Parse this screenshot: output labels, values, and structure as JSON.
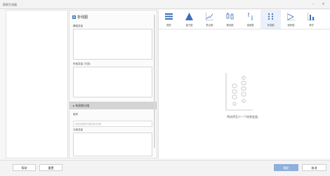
{
  "window": {
    "title": "图表生成器",
    "minimize": "–",
    "close": "×"
  },
  "builder": {
    "title": "折线图",
    "fields": [
      {
        "label": "横轴变量"
      },
      {
        "label": "纵轴变量 (可选)"
      }
    ],
    "section": {
      "label": "▸ 布局和分组"
    },
    "group": {
      "label": "组别",
      "placeholder": "请在此选择分组变量(可选)"
    },
    "panel_label": "分面变量"
  },
  "chart_types": [
    {
      "label": "图形",
      "icon": "chart-menu-icon"
    },
    {
      "label": "直方图",
      "icon": "triangle-icon"
    },
    {
      "label": "散点图",
      "icon": "scatter-icon"
    },
    {
      "label": "箱线图",
      "icon": "boxplot-icon"
    },
    {
      "label": "误差图",
      "icon": "errorbar-icon"
    },
    {
      "label": "折线图",
      "icon": "dotplot-icon",
      "active": true
    },
    {
      "label": "面积图",
      "icon": "area-icon"
    },
    {
      "label": "条形",
      "icon": "bar-icon"
    }
  ],
  "preview": {
    "message": "将选择至少一个结果变量。"
  },
  "footer": {
    "help": "帮助",
    "reset": "重置",
    "ok": "确定",
    "cancel": "取消"
  },
  "colors": {
    "accent": "#3b6fb6",
    "primary_button": "#8fb0db",
    "section_header": "#d4d4d4"
  }
}
